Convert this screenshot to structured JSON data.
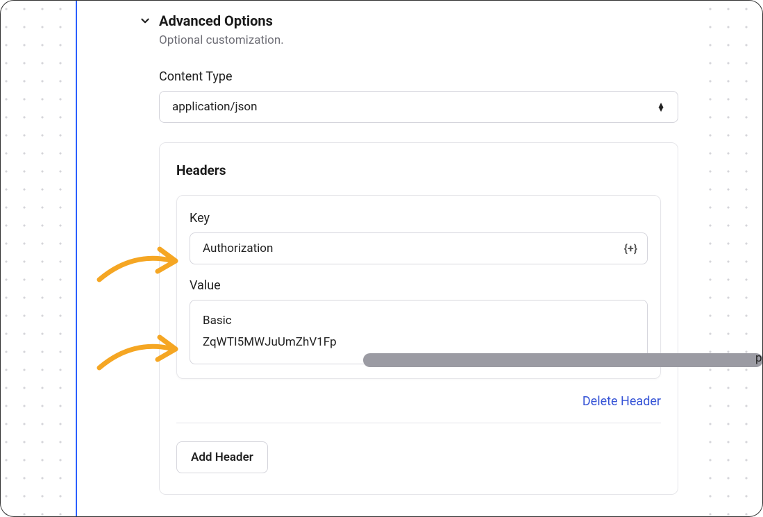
{
  "section": {
    "title": "Advanced Options",
    "subtitle": "Optional customization."
  },
  "contentType": {
    "label": "Content Type",
    "value": "application/json"
  },
  "headers": {
    "title": "Headers",
    "key_label": "Key",
    "key_value": "Authorization",
    "value_label": "Value",
    "value_line1": "Basic",
    "value_line2_prefix": "ZqWTI5MWJuUmZhV1Fp",
    "value_line2_suffix": "p",
    "delete_label": "Delete Header",
    "add_label": "Add Header",
    "variable_icon": "{+}"
  }
}
